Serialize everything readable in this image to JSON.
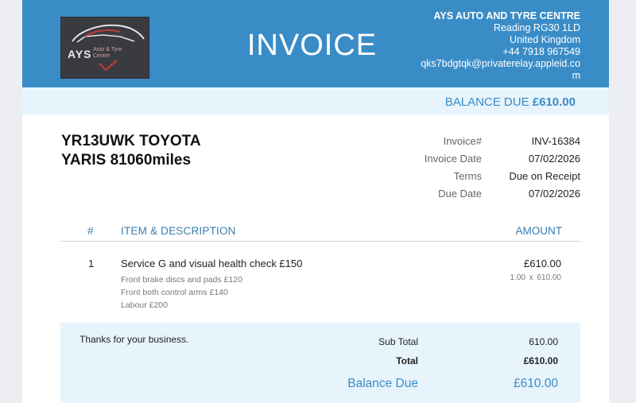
{
  "header": {
    "title": "INVOICE",
    "logo": {
      "main": "AYS",
      "sub_lines": [
        "Auto & Tyre",
        "Centre"
      ]
    },
    "company": {
      "name": "AYS AUTO AND TYRE CENTRE",
      "address_line": "Reading RG30 1LD",
      "country": "United Kingdom",
      "phone": "+44 7918 967549",
      "email": "qks7bdgtqk@privaterelay.appleid.com"
    }
  },
  "balance_band": {
    "label": "BALANCE DUE",
    "amount": "£610.00"
  },
  "vehicle": {
    "line1": "YR13UWK TOYOTA",
    "line2": "YARIS 81060miles"
  },
  "meta": [
    {
      "label": "Invoice#",
      "value": "INV-16384"
    },
    {
      "label": "Invoice Date",
      "value": "07/02/2026"
    },
    {
      "label": "Terms",
      "value": "Due on Receipt"
    },
    {
      "label": "Due Date",
      "value": "07/02/2026"
    }
  ],
  "items_table": {
    "headers": {
      "num": "#",
      "description": "ITEM & DESCRIPTION",
      "amount": "AMOUNT"
    },
    "rows": [
      {
        "num": "1",
        "title": "Service G and visual health check £150",
        "notes": [
          "Front brake discs and pads £120",
          "Front both control arms £140",
          "Labour £200"
        ],
        "amount": "£610.00",
        "qty_line": "1.00  x  610.00"
      }
    ]
  },
  "totals": {
    "thanks": "Thanks for your business.",
    "sub_total_label": "Sub Total",
    "sub_total": "610.00",
    "total_label": "Total",
    "total": "£610.00",
    "balance_label": "Balance Due",
    "balance": "£610.00"
  },
  "colors": {
    "header_bg": "#3a8cc6",
    "band_bg": "#e7f4fc",
    "accent": "#3a8cc6",
    "page_bg": "#eceef2"
  }
}
